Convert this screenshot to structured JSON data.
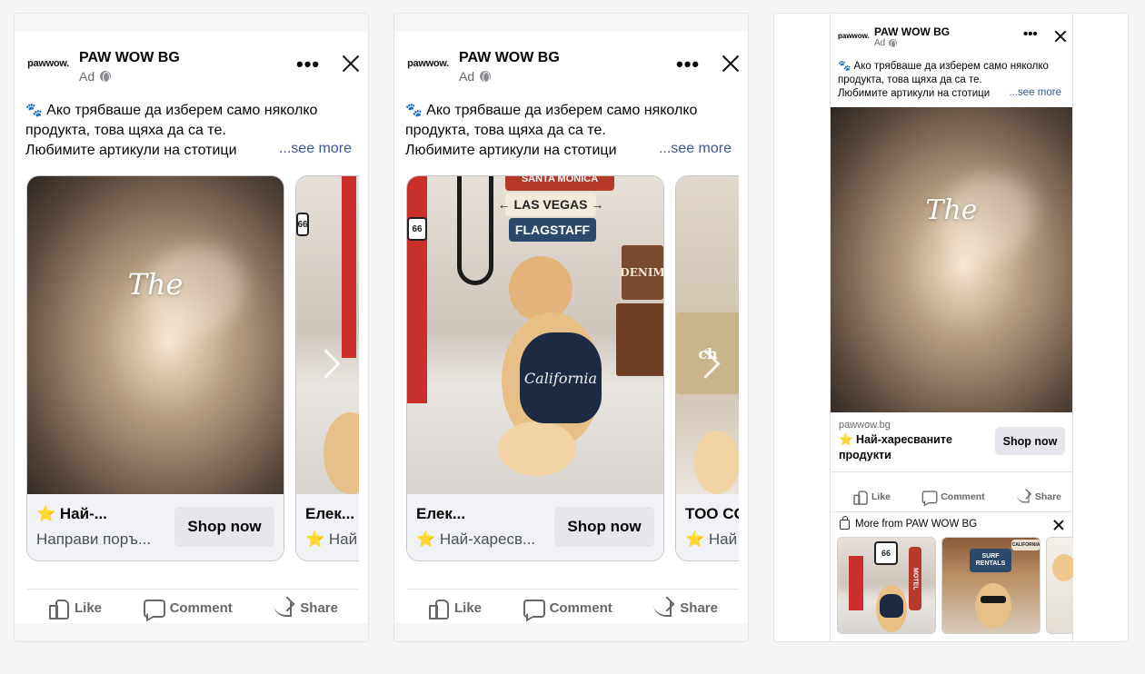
{
  "ad": {
    "brand": "PAW WOW BG",
    "sponsored": "Ad",
    "logo_text": "pawwow.",
    "body_line1": "Ако трябваше да изберем само няколко продукта, това щяха да са те.",
    "body_line2": "Любимите артикули на стотици",
    "paw_emoji": "🐾",
    "see_more": "...see more",
    "like": "Like",
    "comment": "Comment",
    "share": "Share",
    "shop_now": "Shop now"
  },
  "panel1": {
    "cards": [
      {
        "title": "⭐ Най-...",
        "subtitle": "Направи поръ...",
        "overlay": "The"
      },
      {
        "title": "Елек...",
        "subtitle": "⭐ Най"
      }
    ]
  },
  "panel2": {
    "cards": [
      {
        "title": "Елек...",
        "subtitle": "⭐ Най-харесв...",
        "signs": [
          "SANTA MONICA",
          "← LAS VEGAS →",
          "FLAGSTAFF"
        ],
        "crate_text": "DENIM",
        "shirt_text": "California",
        "route": "66"
      },
      {
        "title": "TOO CO",
        "subtitle": "⭐ Най"
      }
    ]
  },
  "panel3": {
    "overlay": "The",
    "domain": "pawwow.bg",
    "product_title": "⭐ Най-харесваните продукти",
    "more_from": "More from PAW WOW BG",
    "thumb_labels": [
      "66",
      "MOTEL",
      "SURF RENTALS",
      "CALIFORNIA"
    ]
  },
  "colors": {
    "link": "#385898",
    "muted": "#65676b",
    "button_bg": "#e4e6eb",
    "page_bg": "#f5f5f5"
  }
}
